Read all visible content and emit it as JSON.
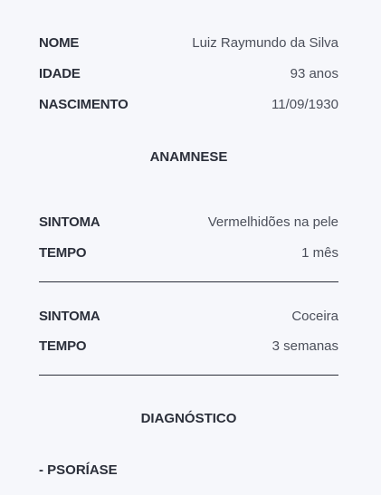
{
  "patient": {
    "name_label": "NOME",
    "name_value": "Luiz Raymundo da Silva",
    "age_label": "IDADE",
    "age_value": "93 anos",
    "birth_label": "NASCIMENTO",
    "birth_value": "11/09/1930"
  },
  "anamnese": {
    "title": "ANAMNESE",
    "entries": [
      {
        "symptom_label": "SINTOMA",
        "symptom_value": "Vermelhidões na pele",
        "time_label": "TEMPO",
        "time_value": "1 mês"
      },
      {
        "symptom_label": "SINTOMA",
        "symptom_value": "Coceira",
        "time_label": "TEMPO",
        "time_value": "3 semanas"
      }
    ]
  },
  "diagnostico": {
    "title": "DIAGNÓSTICO",
    "items": [
      "- PSORÍASE"
    ]
  }
}
